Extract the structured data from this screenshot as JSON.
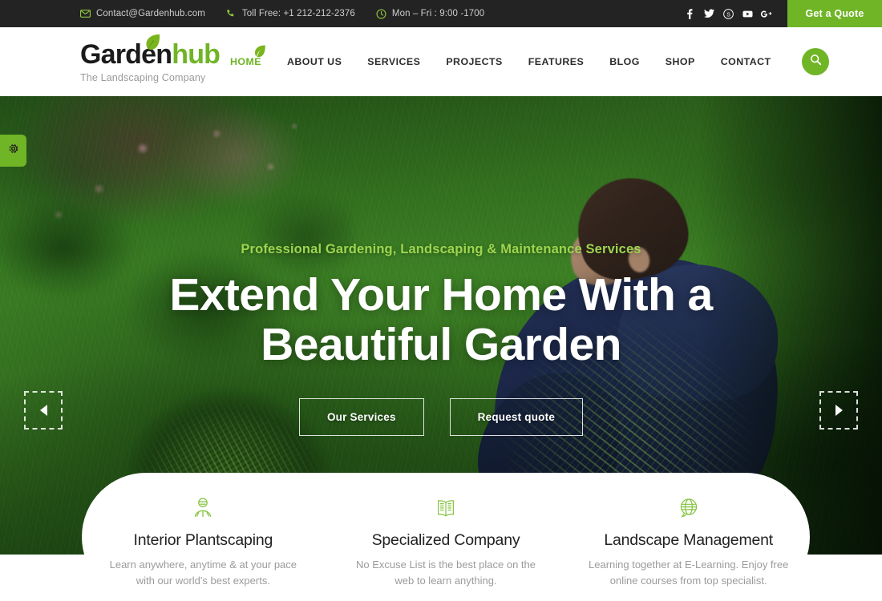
{
  "topbar": {
    "contact_email": "Contact@Gardenhub.com",
    "phone": "Toll Free: +1 212-212-2376",
    "hours": "Mon – Fri : 9:00 -1700",
    "email_icon": "envelope-icon",
    "phone_icon": "phone-icon",
    "clock_icon": "clock-icon",
    "socials": [
      {
        "name": "facebook-icon",
        "label": "f"
      },
      {
        "name": "twitter-icon",
        "label": "t"
      },
      {
        "name": "skype-icon",
        "label": "s"
      },
      {
        "name": "youtube-icon",
        "label": "y"
      },
      {
        "name": "google-plus-icon",
        "label": "G+"
      }
    ],
    "quote_button": "Get a Quote"
  },
  "header": {
    "logo_part1": "Garden",
    "logo_part2": "hub",
    "tagline": "The Landscaping Company",
    "nav": [
      {
        "label": "HOME",
        "active": true
      },
      {
        "label": "ABOUT US",
        "active": false
      },
      {
        "label": "SERVICES",
        "active": false
      },
      {
        "label": "PROJECTS",
        "active": false
      },
      {
        "label": "FEATURES",
        "active": false
      },
      {
        "label": "BLOG",
        "active": false
      },
      {
        "label": "SHOP",
        "active": false
      },
      {
        "label": "CONTACT",
        "active": false
      }
    ],
    "search_icon": "search-icon"
  },
  "hero": {
    "subtitle": "Professional Gardening, Landscaping & Maintenance Services",
    "title_line1": "Extend Your Home With a",
    "title_line2": "Beautiful Garden",
    "primary_button": "Our Services",
    "secondary_button": "Request quote",
    "prev_arrow": "prev-slide-arrow",
    "next_arrow": "next-slide-arrow",
    "settings_icon": "gear-icon"
  },
  "features": [
    {
      "icon": "gardener-person-icon",
      "title": "Interior Plantscaping",
      "desc": "Learn anywhere, anytime & at your pace with our world's best experts."
    },
    {
      "icon": "open-book-icon",
      "title": "Specialized Company",
      "desc": "No Excuse List is the best place on the web to learn anything."
    },
    {
      "icon": "globe-icon",
      "title": "Landscape Management",
      "desc": "Learning together at E-Learning. Enjoy free online courses from top specialist."
    }
  ],
  "colors": {
    "brand_green": "#6fb526",
    "accent_green": "#8dc63f",
    "topbar_bg": "#232323",
    "text_dark": "#222222",
    "muted": "#9b9b9b"
  }
}
